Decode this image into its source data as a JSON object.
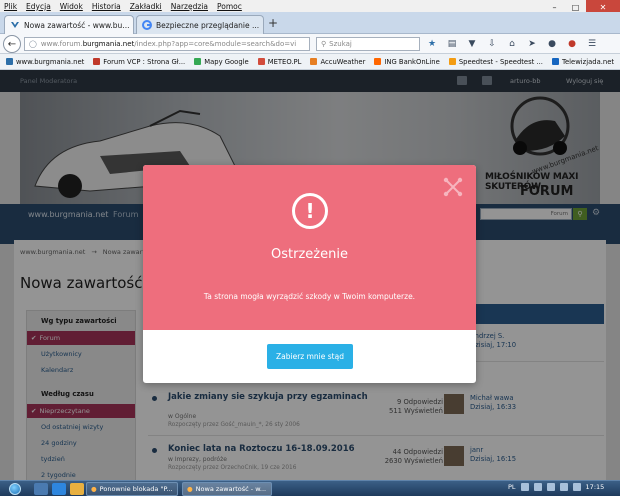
{
  "menubar": {
    "items": [
      "Plik",
      "Edycja",
      "Widok",
      "Historia",
      "Zakładki",
      "Narzędzia",
      "Pomoc"
    ]
  },
  "tabs": [
    {
      "label": "Nowa zawartość - www.bu...",
      "active": true
    },
    {
      "label": "Bezpieczne przeglądanie ...",
      "active": false
    }
  ],
  "navbar": {
    "url_prefix": "www.forum.",
    "url_domain": "burgmania.net",
    "url_rest": "/index.php?app=core&module=search&do=vi",
    "search_placeholder": "Szukaj"
  },
  "bookmarks": [
    {
      "label": "www.burgmania.net",
      "color": "#2c6ea8"
    },
    {
      "label": "Forum VCP : Strona Gł...",
      "color": "#c0392b"
    },
    {
      "label": "Mapy Google",
      "color": "#34a853"
    },
    {
      "label": "METEO.PL",
      "color": "#d24c3c"
    },
    {
      "label": "AccuWeather",
      "color": "#e67e22"
    },
    {
      "label": "ING BankOnLine",
      "color": "#ff6600"
    },
    {
      "label": "Speedtest - Speedtest ...",
      "color": "#f39c12"
    },
    {
      "label": "Telewizjada.net",
      "color": "#1565c0"
    }
  ],
  "forum": {
    "panel_label": "Panel Moderatora",
    "username": "arturo-bb",
    "logout": "Wyloguj się",
    "banner_line1": "MIŁOŚNIKÓW MAXI SKUTERÓW",
    "banner_line2": "FORUM",
    "banner_watermark": "www.burgmania.net",
    "nav_home": "www.burgmania.net",
    "nav_forum": "Forum",
    "search_label": "Forum",
    "breadcrumb": [
      "www.burgmania.net",
      "→",
      "Nowa zawartość"
    ],
    "page_title": "Nowa zawartość",
    "sidebar": {
      "section1_title": "Wg typu zawartości",
      "section1_items": [
        "Forum",
        "Użytkownicy",
        "Kalendarz"
      ],
      "section2_title": "Według czasu",
      "section2_items": [
        "Nieprzeczytane",
        "Od ostatniej wizyty",
        "24 godziny",
        "tydzień",
        "2 tygodnie"
      ]
    },
    "topics": [
      {
        "title": "Jakie zmiany sie szykuja przy egzaminach",
        "category": "w Ogólne",
        "started_by": "Rozpoczęty przez Gość_mauin_*, 26 sty 2006",
        "replies": "9 Odpowiedzi",
        "views": "511 Wyświetleń",
        "last_user": "Michał wawa",
        "last_time": "Dzisiaj, 16:33"
      },
      {
        "title": "Koniec lata na Roztoczu 16-18.09.2016",
        "category": "w Imprezy, podróże",
        "started_by": "Rozpoczęty przez OrzechoCnik, 19 cze 2016",
        "replies": "44 Odpowiedzi",
        "views": "2630 Wyświetleń",
        "last_user": "janr",
        "last_time": "Dzisiaj, 16:15"
      }
    ],
    "partial_top_row": {
      "last_user": "Andrzej S.",
      "last_time": "Dzisiaj, 17:10"
    }
  },
  "modal": {
    "title": "Ostrzeżenie",
    "message": "Ta strona mogła wyrządzić szkody w Twoim komputerze.",
    "button": "Zabierz mnie stąd",
    "accent": "#ee6e7d",
    "button_color": "#2ab0e6"
  },
  "taskbar": {
    "tasks": [
      "Ponownie blokada \"P...",
      "Nowa zawartość - w..."
    ],
    "tray_lang": "PL",
    "clock": "17:15"
  }
}
